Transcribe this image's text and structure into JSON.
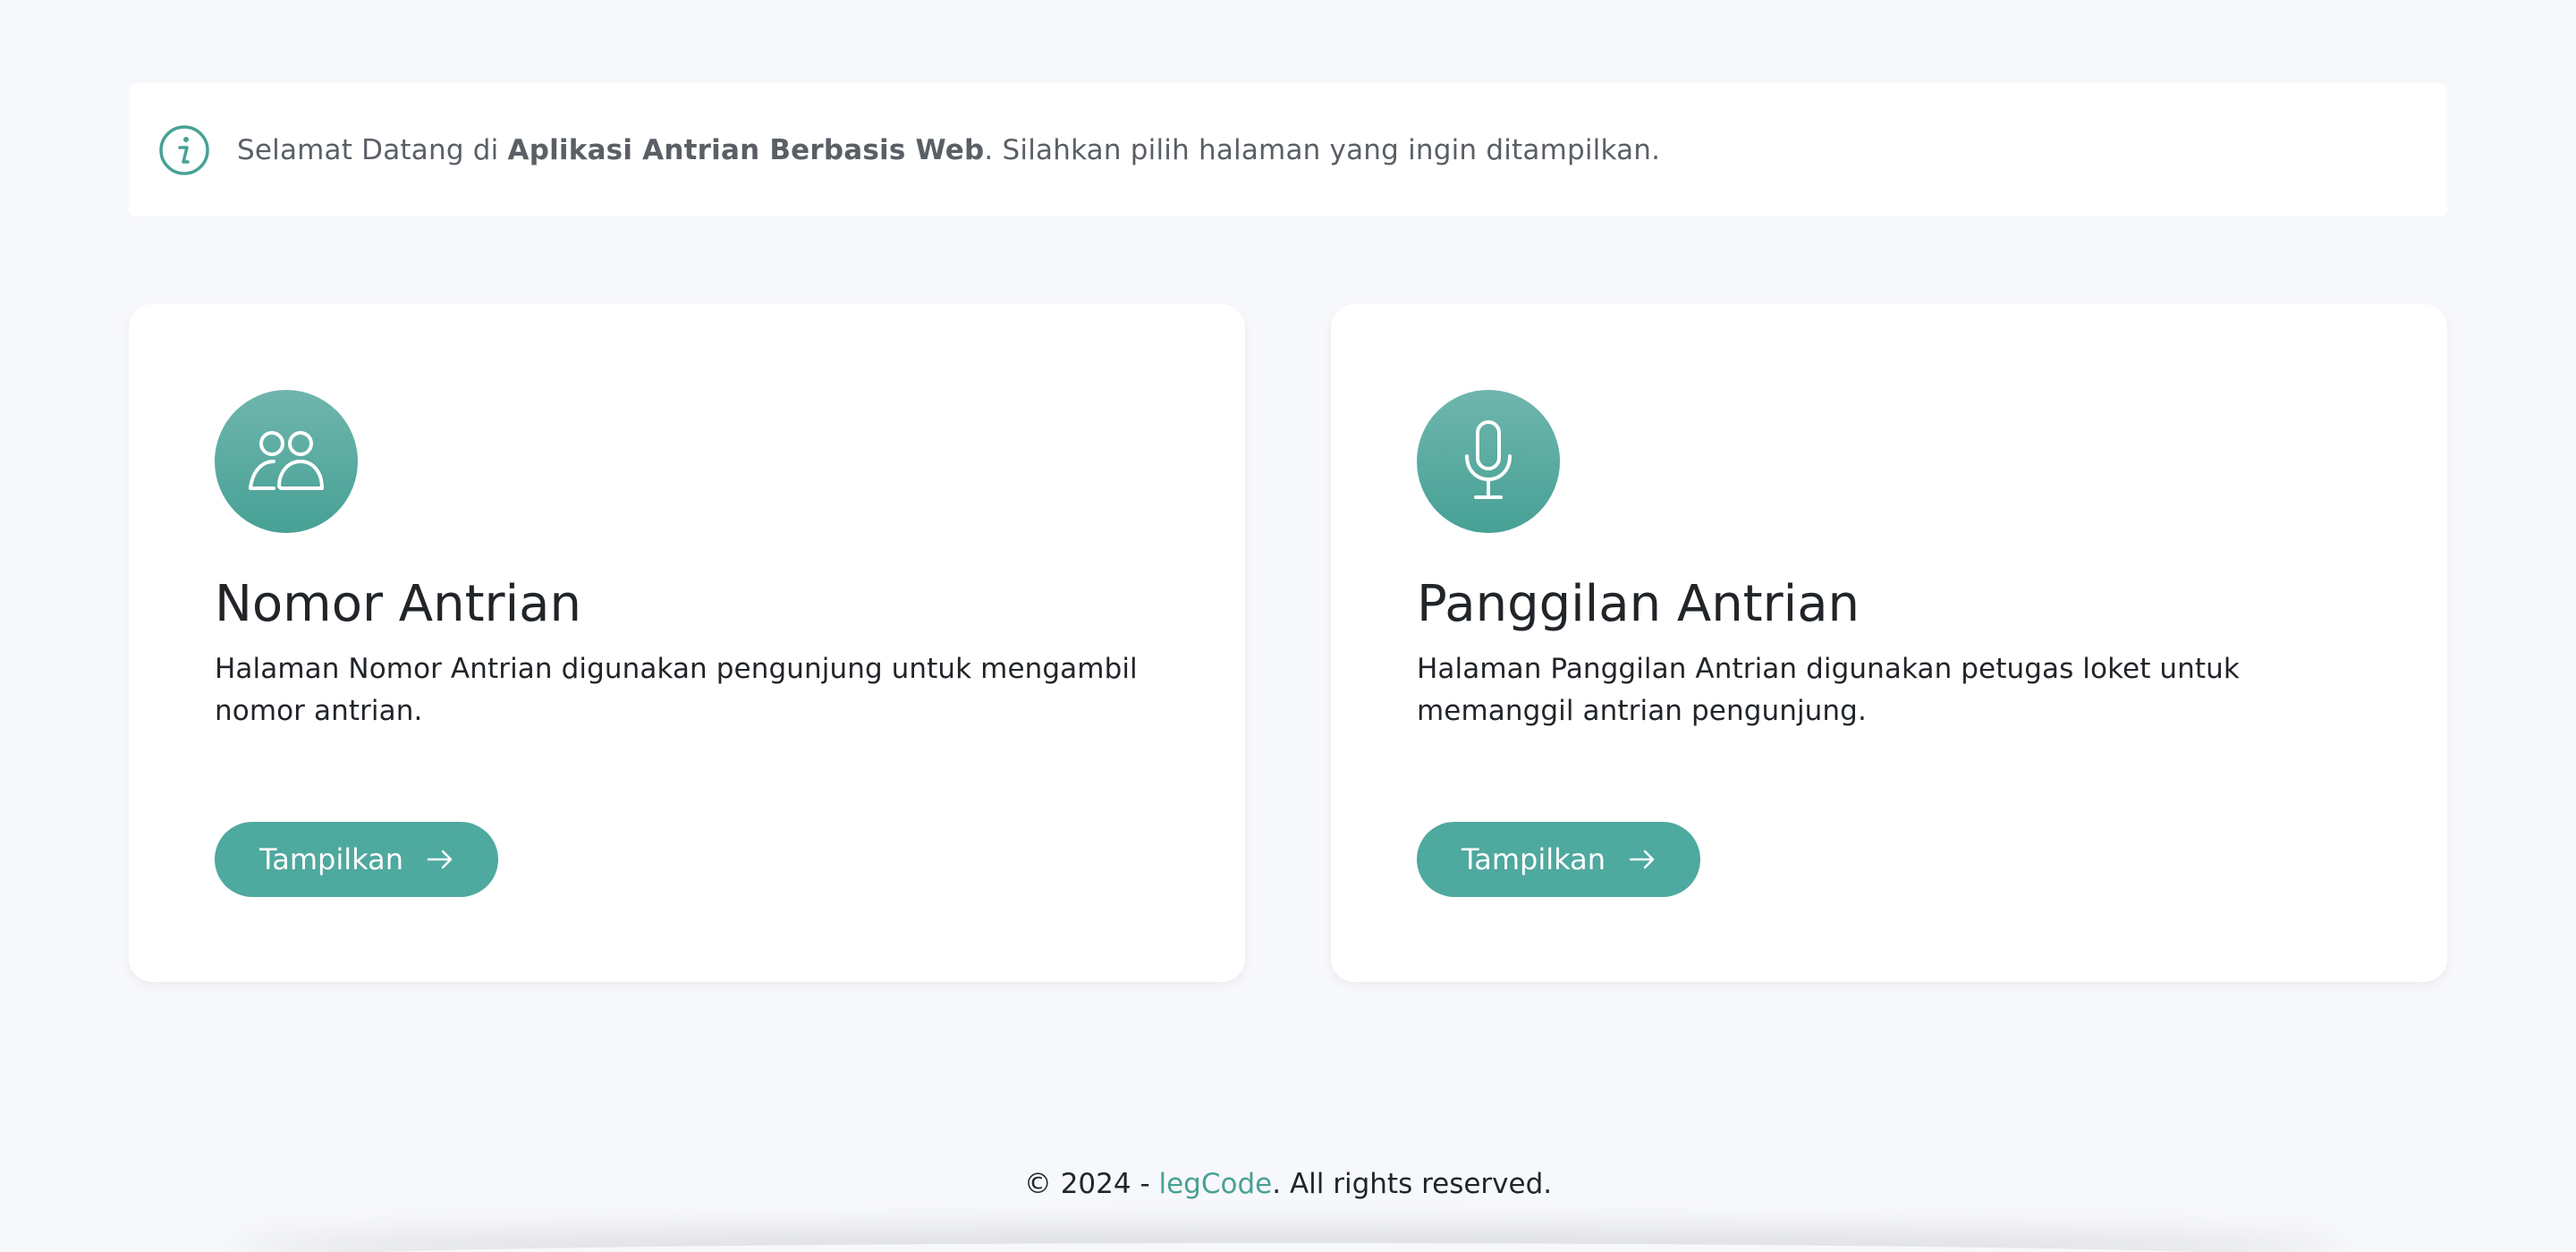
{
  "alert": {
    "icon": "info-circle-icon",
    "prefix": "Selamat Datang di ",
    "app_name": "Aplikasi Antrian Berbasis Web",
    "suffix": ". Silahkan pilih halaman yang ingin ditampilkan."
  },
  "cards": [
    {
      "icon": "people-icon",
      "title": "Nomor Antrian",
      "description": "Halaman Nomor Antrian digunakan pengunjung untuk mengambil nomor antrian.",
      "button_label": "Tampilkan"
    },
    {
      "icon": "microphone-icon",
      "title": "Panggilan Antrian",
      "description": "Halaman Panggilan Antrian digunakan petugas loket untuk memanggil antrian pengunjung.",
      "button_label": "Tampilkan"
    }
  ],
  "footer": {
    "prefix": "© 2024 - ",
    "link_text": "legCode",
    "suffix": ". All rights reserved."
  },
  "colors": {
    "accent": "#4ea99e",
    "background": "#f7f8fc"
  }
}
